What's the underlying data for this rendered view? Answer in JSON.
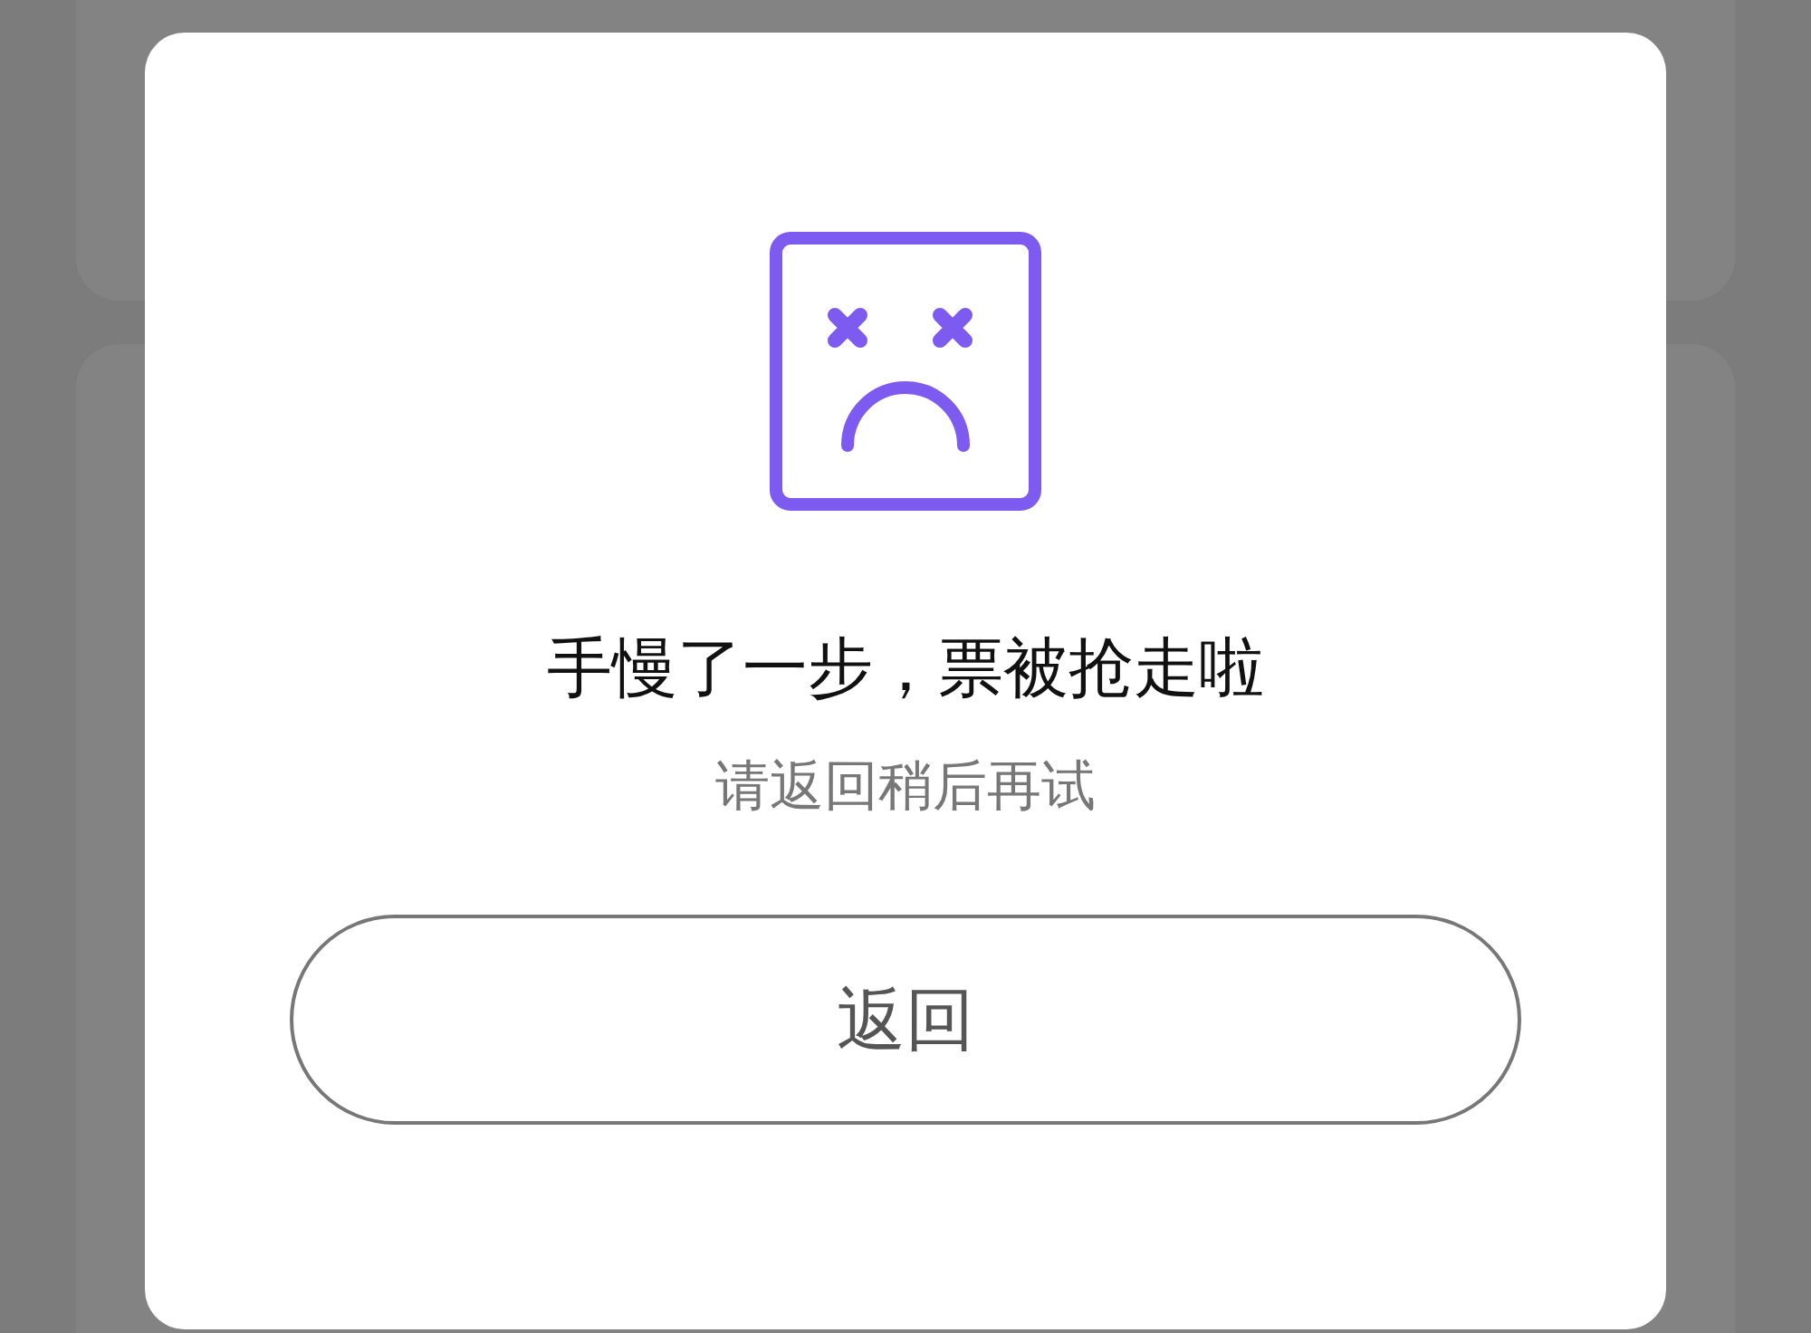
{
  "dialog": {
    "title": "手慢了一步，票被抢走啦",
    "message": "请返回稍后再试",
    "button": "返回"
  }
}
